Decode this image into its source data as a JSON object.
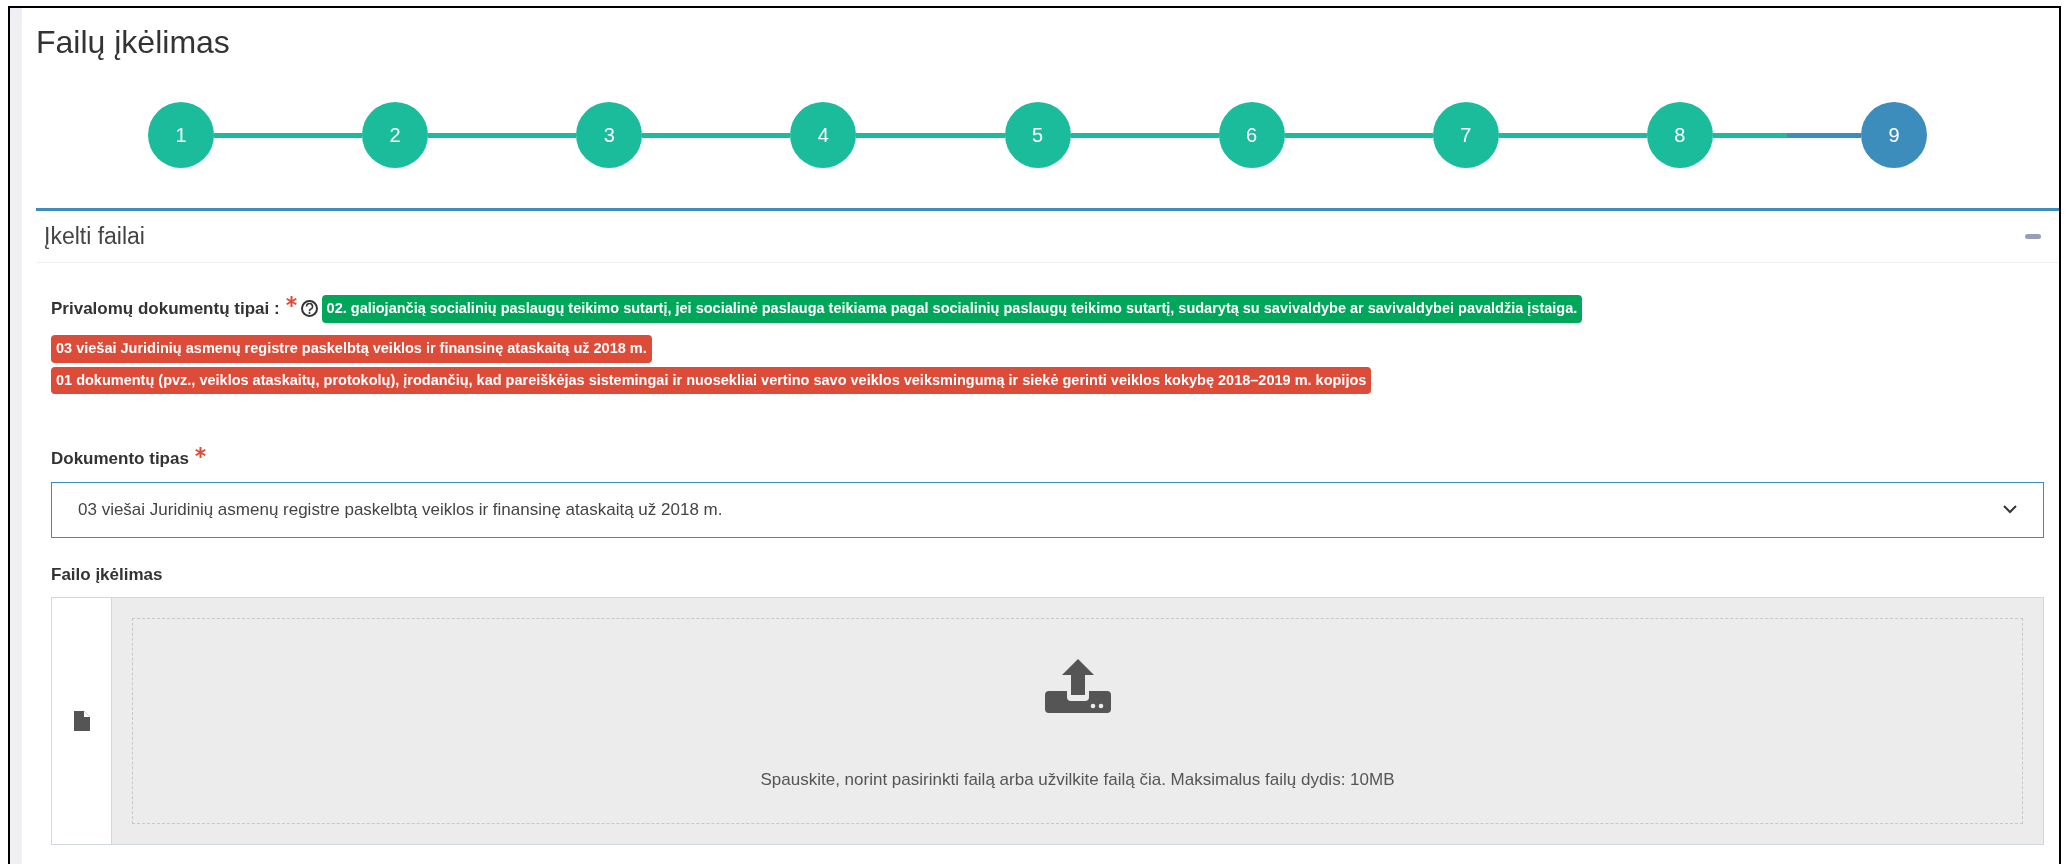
{
  "title": "Failų įkėlimas",
  "steps": [
    {
      "label": "1",
      "active": false
    },
    {
      "label": "2",
      "active": false
    },
    {
      "label": "3",
      "active": false
    },
    {
      "label": "4",
      "active": false
    },
    {
      "label": "5",
      "active": false
    },
    {
      "label": "6",
      "active": false
    },
    {
      "label": "7",
      "active": false
    },
    {
      "label": "8",
      "active": false
    },
    {
      "label": "9",
      "active": true
    }
  ],
  "panel": {
    "title": "Įkelti failai",
    "expanded": true,
    "required_types": {
      "label": "Privalomų dokumentų tipai :",
      "required": true,
      "badges": [
        {
          "text": "02. galiojančią socialinių paslaugų teikimo sutartį, jei socialinė paslauga teikiama pagal socialinių paslaugų teikimo sutartį, sudarytą su savivaldybe ar savivaldybei pavaldžia įstaiga.",
          "uploaded": true
        },
        {
          "text": "03 viešai Juridinių asmenų registre paskelbtą veiklos ir finansinę ataskaitą už 2018 m.",
          "uploaded": false
        },
        {
          "text": "01 dokumentų (pvz., veiklos ataskaitų, protokolų), įrodančių, kad pareiškėjas sistemingai ir nuosekliai vertino savo veiklos veiksmingumą ir siekė gerinti veiklos kokybę 2018–2019 m. kopijos",
          "uploaded": false
        }
      ]
    },
    "document_type": {
      "label": "Dokumento tipas",
      "required": true,
      "value": "03 viešai Juridinių asmenų registre paskelbtą veiklos ir finansinę ataskaitą už 2018 m."
    },
    "file_upload": {
      "label": "Failo įkėlimas",
      "hint": "Spauskite, norint pasirinkti failą arba užvilkite failą čia. Maksimalus failų dydis: 10MB"
    }
  }
}
